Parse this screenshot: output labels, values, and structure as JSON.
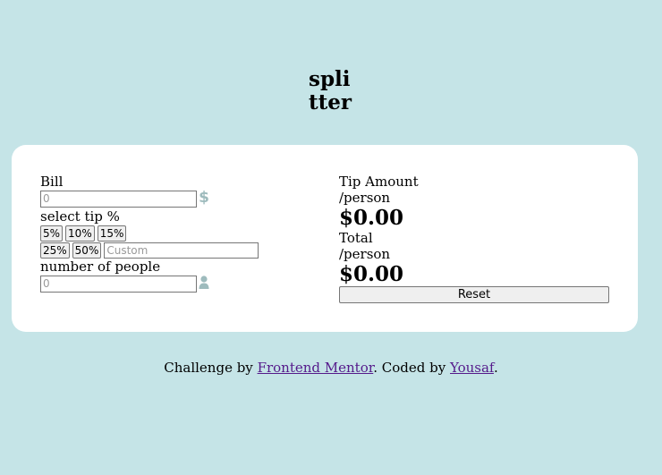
{
  "logo": {
    "line1": "spli",
    "line2": "tter"
  },
  "bill": {
    "label": "Bill",
    "placeholder": "0",
    "icon": "dollar-icon"
  },
  "tip": {
    "label": "select tip %",
    "options": [
      "5%",
      "10%",
      "15%",
      "25%",
      "50%"
    ],
    "custom_placeholder": "Custom"
  },
  "people": {
    "label": "number of people",
    "placeholder": "0",
    "icon": "person-icon"
  },
  "results": {
    "tip_label": "Tip Amount",
    "tip_sub": "/person",
    "tip_value": "$0.00",
    "total_label": "Total",
    "total_sub": "/person",
    "total_value": "$0.00",
    "reset_label": "Reset"
  },
  "footer": {
    "prefix": "Challenge by ",
    "link1": "Frontend Mentor",
    "middle": ". Coded by ",
    "link2": "Yousaf",
    "suffix": "."
  },
  "colors": {
    "background": "#c5e4e7",
    "card": "#ffffff",
    "icon": "#9ebbbd",
    "link": "#551a8b"
  }
}
